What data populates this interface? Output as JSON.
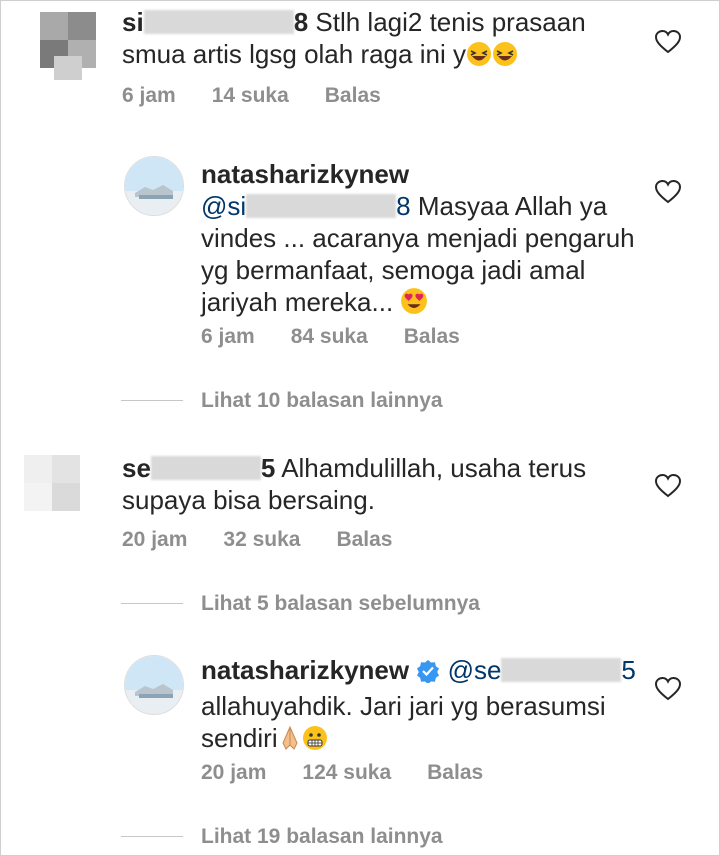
{
  "comments": [
    {
      "user_prefix": "si",
      "user_suffix": "8",
      "text_line1": "Stlh lagi2 tenis prasaan",
      "text_line2": "smua artis lgsg olah raga ini y",
      "time": "6 jam",
      "likes": "14 suka",
      "reply": "Balas"
    },
    {
      "user": "natasharizkynew",
      "mention_prefix": "@si",
      "mention_suffix": "8",
      "text_line1": "Masyaa Allah ya",
      "text_line2": "vindes ... acaranya menjadi pengaruh",
      "text_line3": "yg bermanfaat, semoga jadi amal",
      "text_line4": "jariyah mereka...",
      "time": "6 jam",
      "likes": "84 suka",
      "reply": "Balas"
    },
    {
      "more": "Lihat 10 balasan lainnya"
    },
    {
      "user_prefix": "se",
      "user_suffix": "5",
      "text_line1": "Alhamdulillah, usaha terus",
      "text_line2": "supaya bisa bersaing.",
      "time": "20 jam",
      "likes": "32 suka",
      "reply": "Balas"
    },
    {
      "more": "Lihat 5 balasan sebelumnya"
    },
    {
      "user": "natasharizkynew",
      "mention_prefix": "@se",
      "mention_suffix": "5",
      "text_line1": "allahuyahdik. Jari jari yg berasumsi",
      "text_line2": "sendiri",
      "time": "20 jam",
      "likes": "124 suka",
      "reply": "Balas"
    },
    {
      "more": "Lihat 19 balasan lainnya"
    }
  ],
  "icons": {
    "heart": "heart-icon",
    "verified": "verified-badge-icon",
    "emoji_laugh": "laughing-emoji",
    "emoji_love": "heart-eyes-emoji",
    "emoji_pray": "folded-hands-emoji",
    "emoji_grimace": "grimacing-emoji"
  },
  "colors": {
    "text": "#262626",
    "meta": "#8e8e8e",
    "verified": "#3897f0"
  }
}
